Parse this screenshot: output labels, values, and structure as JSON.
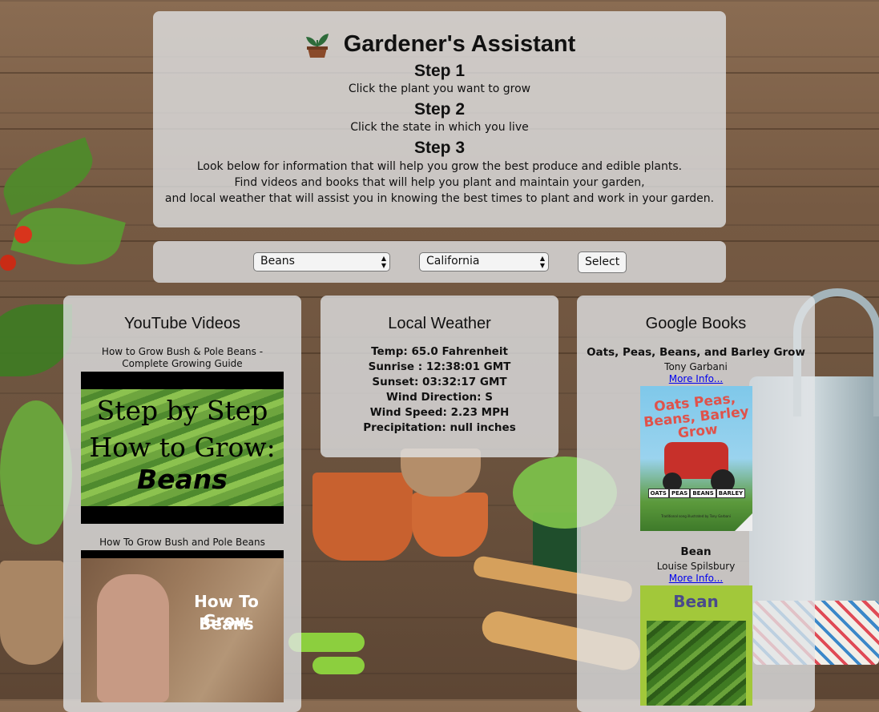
{
  "header": {
    "title": "Gardener's Assistant",
    "steps": [
      {
        "heading": "Step 1",
        "text": "Click the plant you want to grow"
      },
      {
        "heading": "Step 2",
        "text": "Click the state in which you live"
      },
      {
        "heading": "Step 3",
        "lines": [
          "Look below for information that will help you grow the best produce and edible plants.",
          "Find videos and books that will help you plant and maintain your garden,",
          "and local weather that will assist you in knowing the best times to plant and work in your garden."
        ]
      }
    ]
  },
  "controls": {
    "plant_selected": "Beans",
    "state_selected": "California",
    "select_button": "Select"
  },
  "videos": {
    "heading": "YouTube Videos",
    "items": [
      {
        "title": "How to Grow Bush & Pole Beans - Complete Growing Guide",
        "thumb_text": [
          "Step by Step",
          "How to Grow:",
          "Beans"
        ]
      },
      {
        "title": "How To Grow Bush and Pole Beans",
        "thumb_text": [
          "How To Grow",
          "Beans"
        ]
      }
    ]
  },
  "weather": {
    "heading": "Local Weather",
    "lines": [
      "Temp: 65.0 Fahrenheit",
      "Sunrise : 12:38:01 GMT",
      "Sunset: 03:32:17 GMT",
      "Wind Direction: S",
      "Wind Speed: 2.23 MPH",
      "Precipitation: null inches"
    ]
  },
  "books": {
    "heading": "Google Books",
    "items": [
      {
        "title": "Oats, Peas, Beans, and Barley Grow",
        "author": "Tony Garbani",
        "link": "More Info...",
        "cover_text": "Oats Peas, Beans, Barley Grow",
        "cover_sub": "Traditional song illustrated by Tony Garbani",
        "cover_signs": [
          "OATS",
          "PEAS",
          "BEANS",
          "BARLEY"
        ]
      },
      {
        "title": "Bean",
        "author": "Louise Spilsbury",
        "link": "More Info...",
        "cover_text": "Bean"
      }
    ]
  },
  "colors": {
    "panel": "#e1e4e7",
    "link": "#0000ee",
    "wood": "#765a43"
  }
}
